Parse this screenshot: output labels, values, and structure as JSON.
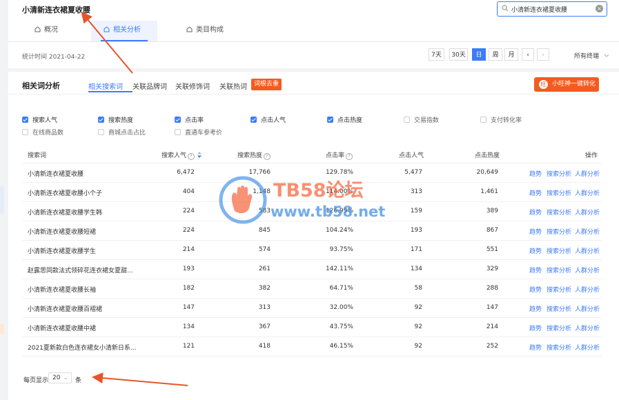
{
  "header": {
    "keyword_title": "小清新连衣裙夏收腰",
    "search": {
      "value": "小清新连衣裙夏收腰"
    },
    "tabs": [
      {
        "label": "概况"
      },
      {
        "label": "相关分析"
      },
      {
        "label": "类目构成"
      }
    ],
    "stat_date": "统计时间 2021-04-22",
    "range_buttons": [
      "7天",
      "30天",
      "日",
      "周",
      "月"
    ],
    "active_range": "日",
    "nav_prev": "‹",
    "nav_next": "›",
    "channel": "所有终端"
  },
  "analysis": {
    "title": "相关词分析",
    "subtabs": [
      "相关搜索词",
      "关联品牌词",
      "关联修饰词",
      "关联热词"
    ],
    "root_button": "词根去重",
    "convert_button": "小旺神一键转化",
    "metric_options": [
      {
        "label": "搜索人气",
        "checked": true
      },
      {
        "label": "搜索热度",
        "checked": true
      },
      {
        "label": "点击率",
        "checked": true
      },
      {
        "label": "点击人气",
        "checked": true
      },
      {
        "label": "点击热度",
        "checked": true
      },
      {
        "label": "交易指数",
        "checked": false
      },
      {
        "label": "支付转化率",
        "checked": false
      },
      {
        "label": "在线商品数",
        "checked": false
      },
      {
        "label": "商城点击占比",
        "checked": false
      },
      {
        "label": "直通车参考价",
        "checked": false
      }
    ],
    "columns": [
      "搜索词",
      "搜索人气",
      "搜索热度",
      "点击率",
      "点击人气",
      "点击热度",
      "操作"
    ],
    "actions": [
      "趋势",
      "搜索分析",
      "人群分析"
    ],
    "rows": [
      {
        "keyword": "小清新连衣裙夏收腰",
        "pop": "6,472",
        "heat": "17,766",
        "ctr": "129.78%",
        "click_pop": "5,477",
        "click_heat": "20,649"
      },
      {
        "keyword": "小清新连衣裙夏收腰小个子",
        "pop": "404",
        "heat": "1,148",
        "ctr": "114.00%",
        "click_pop": "313",
        "click_heat": "1,461"
      },
      {
        "keyword": "小清新连衣裙夏收腰学生韩",
        "pop": "224",
        "heat": "583",
        "ctr": "126.99%",
        "click_pop": "159",
        "click_heat": "389"
      },
      {
        "keyword": "小清新连衣裙夏收腰短裙",
        "pop": "224",
        "heat": "845",
        "ctr": "104.24%",
        "click_pop": "193",
        "click_heat": "867"
      },
      {
        "keyword": "小清新连衣裙夏收腰学生",
        "pop": "214",
        "heat": "574",
        "ctr": "93.75%",
        "click_pop": "171",
        "click_heat": "551"
      },
      {
        "keyword": "赵露思同款法式领碎花连衣裙女夏甜...",
        "pop": "193",
        "heat": "261",
        "ctr": "142.11%",
        "click_pop": "134",
        "click_heat": "329"
      },
      {
        "keyword": "小清新连衣裙夏收腰长袖",
        "pop": "182",
        "heat": "382",
        "ctr": "64.71%",
        "click_pop": "58",
        "click_heat": "288"
      },
      {
        "keyword": "小清新连衣裙夏收腰百褶裙",
        "pop": "147",
        "heat": "313",
        "ctr": "32.00%",
        "click_pop": "92",
        "click_heat": "147"
      },
      {
        "keyword": "小清新连衣裙夏收腰中裙",
        "pop": "134",
        "heat": "367",
        "ctr": "43.75%",
        "click_pop": "92",
        "click_heat": "214"
      },
      {
        "keyword": "2021夏新款白色连衣裙女小清新日系...",
        "pop": "121",
        "heat": "418",
        "ctr": "46.15%",
        "click_pop": "92",
        "click_heat": "252"
      }
    ],
    "pager": {
      "label": "每页显示",
      "value": "20",
      "unit": "条"
    }
  },
  "watermark": {
    "line1": "TB58论坛",
    "line2": "www.tb58.net"
  },
  "colors": {
    "accent": "#3c7cfa",
    "orange": "#f55a1f",
    "annotation": "#e8532a"
  }
}
